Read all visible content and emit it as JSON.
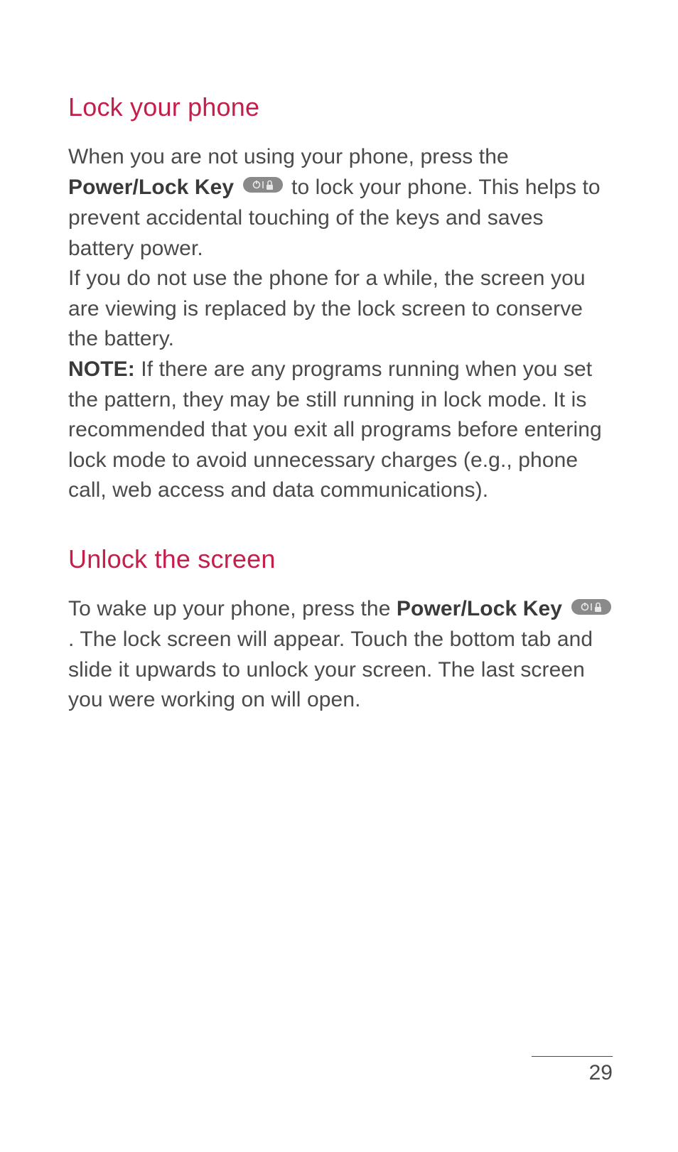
{
  "section1": {
    "heading": "Lock your phone",
    "p1_a": "When you are not using your phone, press the ",
    "p1_bold": "Power/Lock Key",
    "p1_b": " to lock your phone. This helps to prevent accidental touching of the keys and saves battery power.",
    "p2": "If you do not use the phone for a while, the screen you are viewing is replaced by the lock screen  to conserve the battery.",
    "p3_bold": "NOTE:",
    "p3_rest": " If there are any programs running when you set the pattern, they may be still running in lock mode. It is recommended that you exit all programs before entering lock mode to avoid unnecessary charges (e.g., phone call, web access and data communications)."
  },
  "section2": {
    "heading": "Unlock the screen",
    "p1_a": "To wake up your phone, press the ",
    "p1_bold": "Power/Lock Key",
    "p1_b": ". The lock screen will appear. Touch the bottom tab and slide it upwards to unlock your screen. The last screen you were working on will open."
  },
  "page_number": "29"
}
